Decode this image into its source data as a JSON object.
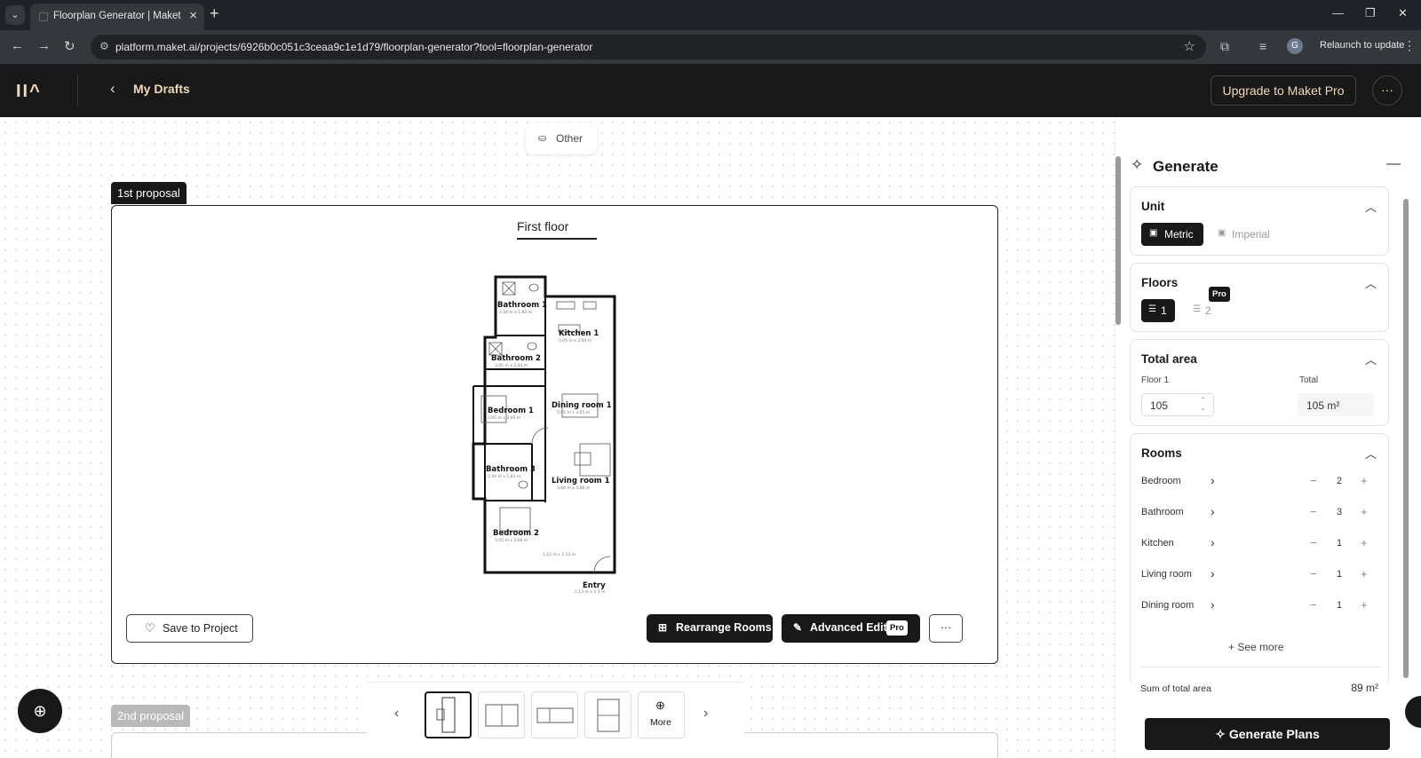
{
  "browser": {
    "tab_title": "Floorplan Generator | Maket",
    "url": "platform.maket.ai/projects/6926b0c051c3ceaa9c1e1d79/floorplan-generator?tool=floorplan-generator",
    "profile_initial": "G",
    "relaunch_label": "Relaunch to update"
  },
  "header": {
    "logo": "II^",
    "back_label": "My Drafts",
    "upgrade_label": "Upgrade to Maket Pro"
  },
  "canvas": {
    "style_chip": "Other",
    "proposal1_tag": "1st proposal",
    "proposal2_tag": "2nd proposal",
    "floor_title": "First floor",
    "save_label": "Save to Project",
    "rearrange_label": "Rearrange Rooms",
    "advanced_label": "Advanced Edit",
    "pro_badge": "Pro",
    "more_label": "More"
  },
  "plan": {
    "rooms": [
      {
        "name": "Bathroom 1",
        "dims": "2.44 m x 1.83 m"
      },
      {
        "name": "Kitchen 1",
        "dims": "3.05 m x 2.44 m"
      },
      {
        "name": "Bathroom 2",
        "dims": "3.05 m x 2.44 m"
      },
      {
        "name": "Bedroom 1",
        "dims": "3.05 m x 3.05 m"
      },
      {
        "name": "Dining room 1",
        "dims": "3.05 m x 3.05 m"
      },
      {
        "name": "Bathroom 3",
        "dims": "2.44 m x 1.83 m"
      },
      {
        "name": "Living room 1",
        "dims": "3.66 m x 4.88 m"
      },
      {
        "name": "Bedroom 2",
        "dims": "3.05 m x 3.66 m"
      },
      {
        "name": "Entry",
        "dims": "2.13 m x 1.3 m"
      }
    ],
    "hall_dims": "1.22 m x 2.13 m"
  },
  "panel": {
    "title": "Generate",
    "unit": {
      "title": "Unit",
      "metric": "Metric",
      "imperial": "Imperial"
    },
    "floors": {
      "title": "Floors",
      "opt1": "1",
      "opt2": "2",
      "pro": "Pro"
    },
    "area": {
      "title": "Total area",
      "floor_label": "Floor 1",
      "total_label": "Total",
      "floor_value": "105",
      "total_value": "105 m²"
    },
    "rooms": {
      "title": "Rooms",
      "items": [
        {
          "name": "Bedroom",
          "count": "2"
        },
        {
          "name": "Bathroom",
          "count": "3"
        },
        {
          "name": "Kitchen",
          "count": "1"
        },
        {
          "name": "Living room",
          "count": "1"
        },
        {
          "name": "Dining room",
          "count": "1"
        }
      ],
      "see_more": "See more"
    },
    "sum_label": "Sum of total area",
    "sum_value": "89 m²",
    "generate_label": "Generate Plans"
  }
}
